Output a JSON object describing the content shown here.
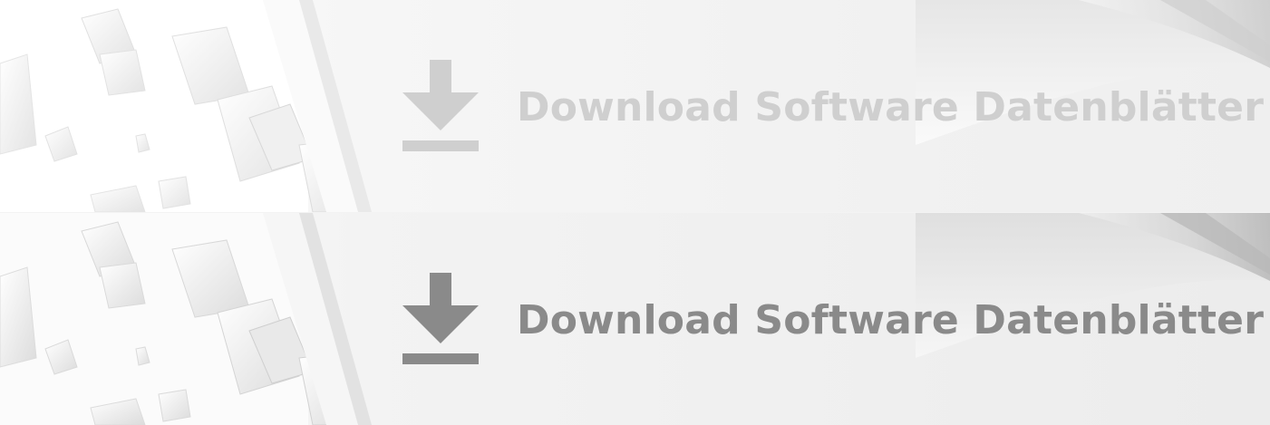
{
  "banners": [
    {
      "state": "default",
      "label": "Download Software Datenblätter",
      "icon": "download-icon",
      "color": "#cfcfcf"
    },
    {
      "state": "hover",
      "label": "Download Software Datenblätter",
      "icon": "download-icon",
      "color": "#8a8a8a"
    }
  ]
}
